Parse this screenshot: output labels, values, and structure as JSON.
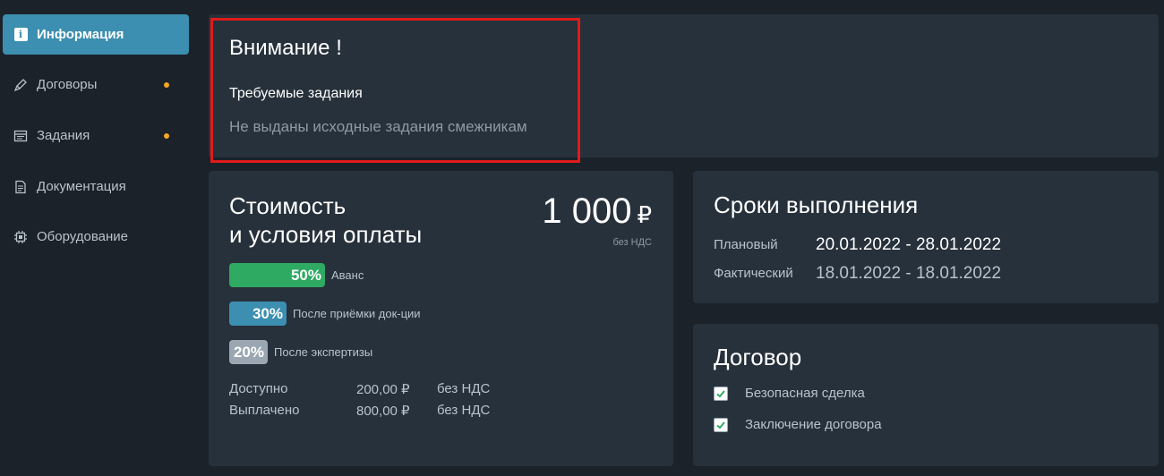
{
  "sidebar": {
    "items": [
      {
        "label": "Информация",
        "icon": "info-icon",
        "active": true
      },
      {
        "label": "Договоры",
        "icon": "pen-icon",
        "dot": true
      },
      {
        "label": "Задания",
        "icon": "window-icon",
        "dot": true
      },
      {
        "label": "Документация",
        "icon": "document-icon"
      },
      {
        "label": "Оборудование",
        "icon": "chip-icon"
      }
    ]
  },
  "alert": {
    "title": "Внимание !",
    "subtitle": "Требуемые задания",
    "message": "Не выданы исходные задания смежникам"
  },
  "cost": {
    "title_line1": "Стоимость",
    "title_line2": "и условия оплаты",
    "amount": "1 000",
    "currency": "₽",
    "vat_note": "без НДС",
    "stages": [
      {
        "percent": "50%",
        "label": "Аванс",
        "value": 50,
        "color": "#2eaa63"
      },
      {
        "percent": "30%",
        "label": "После приёмки док-ции",
        "value": 30,
        "color": "#3c8fb0"
      },
      {
        "percent": "20%",
        "label": "После экспертизы",
        "value": 20,
        "color": "#9aa6b1"
      }
    ],
    "rows": [
      {
        "label": "Доступно",
        "amount": "200,00 ₽",
        "vat": "без НДС"
      },
      {
        "label": "Выплачено",
        "amount": "800,00 ₽",
        "vat": "без НДС"
      }
    ]
  },
  "deadlines": {
    "title": "Сроки выполнения",
    "planned_label": "Плановый",
    "planned_value": "20.01.2022 - 28.01.2022",
    "actual_label": "Фактический",
    "actual_value": "18.01.2022 - 18.01.2022"
  },
  "contract": {
    "title": "Договор",
    "items": [
      {
        "label": "Безопасная сделка",
        "checked": true
      },
      {
        "label": "Заключение договора",
        "checked": true
      }
    ]
  }
}
